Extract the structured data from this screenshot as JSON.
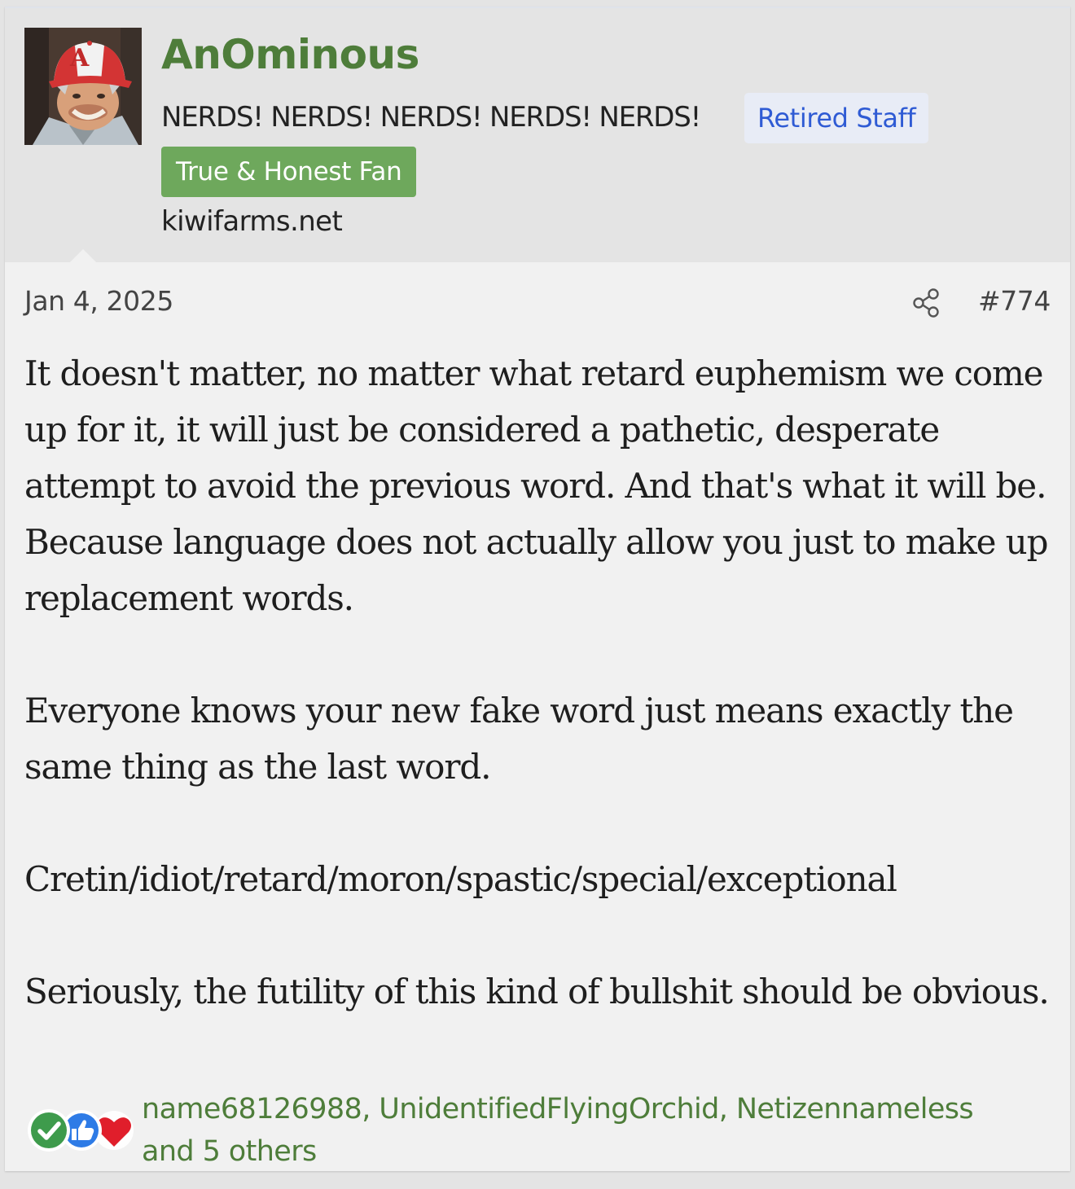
{
  "post": {
    "username": "AnOminous",
    "user_title": "NERDS! NERDS! NERDS! NERDS! NERDS!",
    "banner_staff": "Retired Staff",
    "banner_fan": "True & Honest Fan",
    "site": "kiwifarms.net",
    "date": "Jan 4, 2025",
    "number": "#774",
    "avatar_cap_letter": "A",
    "paragraphs": [
      "It doesn't matter, no matter what retard euphemism we come up for it, it will just be considered a pathetic, desperate attempt to avoid the previous word. And that's what it will be. Because language does not actually allow you just to make up replacement words.",
      "Everyone knows your new fake word just means exactly the same thing as the last word.",
      "Cretin/idiot/retard/moron/spastic/special/exceptional",
      "Seriously, the futility of this kind of bullshit should be obvious."
    ],
    "reactions": {
      "icons": [
        "check-icon",
        "thumbs-up-icon",
        "heart-icon"
      ],
      "users_text": "name68126988, UnidentifiedFlyingOrchid, Netizennameless",
      "others_text": "and 5 others"
    }
  },
  "colors": {
    "username": "#4e7d3a",
    "staff_badge_text": "#2f5bd4",
    "fan_badge_bg": "#6ea85c",
    "header_bg": "#e4e4e4",
    "body_bg": "#f1f1f1"
  }
}
